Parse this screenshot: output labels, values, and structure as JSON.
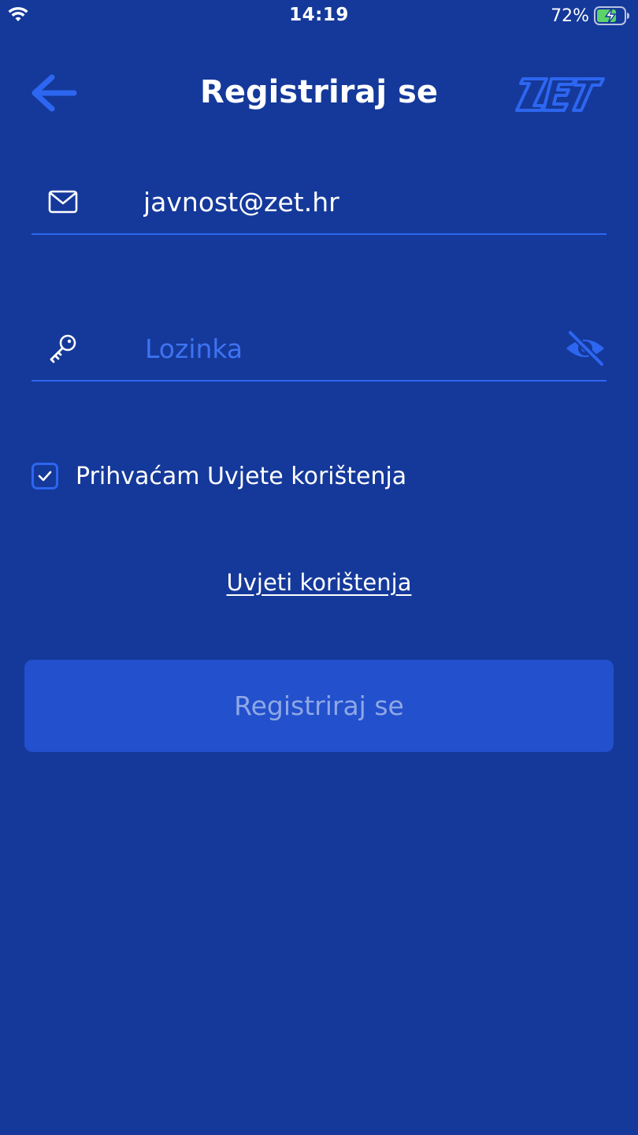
{
  "status_bar": {
    "time": "14:19",
    "battery_percent": "72%",
    "icons": [
      "wifi-icon",
      "battery-charging-icon"
    ]
  },
  "header": {
    "title": "Registriraj se",
    "back_icon": "arrow-left-icon",
    "logo_text": "ZET"
  },
  "form": {
    "email": {
      "icon": "mail-icon",
      "value": "javnost@zet.hr"
    },
    "password": {
      "icon": "key-icon",
      "placeholder": "Lozinka",
      "visibility_icon": "eye-off-icon"
    },
    "terms_checkbox": {
      "checked": true,
      "label": "Prihvaćam Uvjete korištenja"
    },
    "terms_link": "Uvjeti korištenja",
    "submit_label": "Registriraj se"
  },
  "colors": {
    "background": "#15399a",
    "accent": "#2d66f0",
    "button_fill": "#2350cc",
    "button_text_disabled": "#8ea8e6",
    "placeholder": "#3e73f2"
  }
}
